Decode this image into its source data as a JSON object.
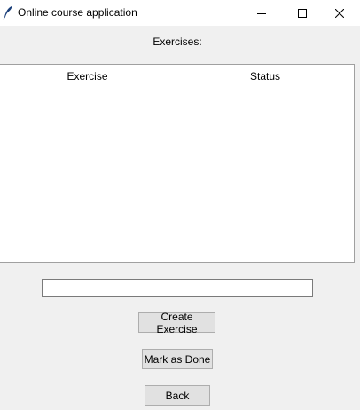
{
  "window": {
    "title": "Online course application",
    "icons": {
      "app": "feather-icon",
      "minimize": "minimize-icon",
      "maximize": "maximize-icon",
      "close": "close-icon"
    }
  },
  "main": {
    "section_label": "Exercises:",
    "table": {
      "columns": [
        "Exercise",
        "Status"
      ],
      "rows": []
    },
    "entry": {
      "value": ""
    },
    "buttons": {
      "create": "Create Exercise",
      "mark_done": "Mark as Done",
      "back": "Back"
    }
  }
}
